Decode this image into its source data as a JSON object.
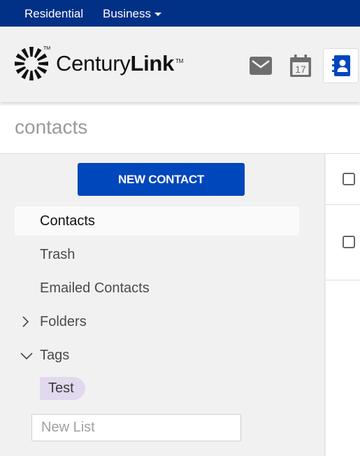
{
  "topnav": {
    "residential": "Residential",
    "business": "Business"
  },
  "brand": {
    "name_light": "Century",
    "name_bold": "Link",
    "tm": "TM"
  },
  "apps": {
    "mail_label": "Mail",
    "calendar_day": "17",
    "contacts_label": "Contacts",
    "active_color": "#0047bb"
  },
  "page": {
    "title": "contacts"
  },
  "sidebar": {
    "new_contact_label": "NEW CONTACT",
    "items": [
      {
        "label": "Contacts",
        "active": true
      },
      {
        "label": "Trash"
      },
      {
        "label": "Emailed Contacts"
      },
      {
        "label": "Folders",
        "expandable": true,
        "expanded": false
      },
      {
        "label": "Tags",
        "expandable": true,
        "expanded": true
      }
    ],
    "tags": [
      {
        "label": "Test",
        "color": "#e3d9ef"
      }
    ],
    "new_list_placeholder": "New List"
  },
  "list": {
    "rows": 2
  }
}
